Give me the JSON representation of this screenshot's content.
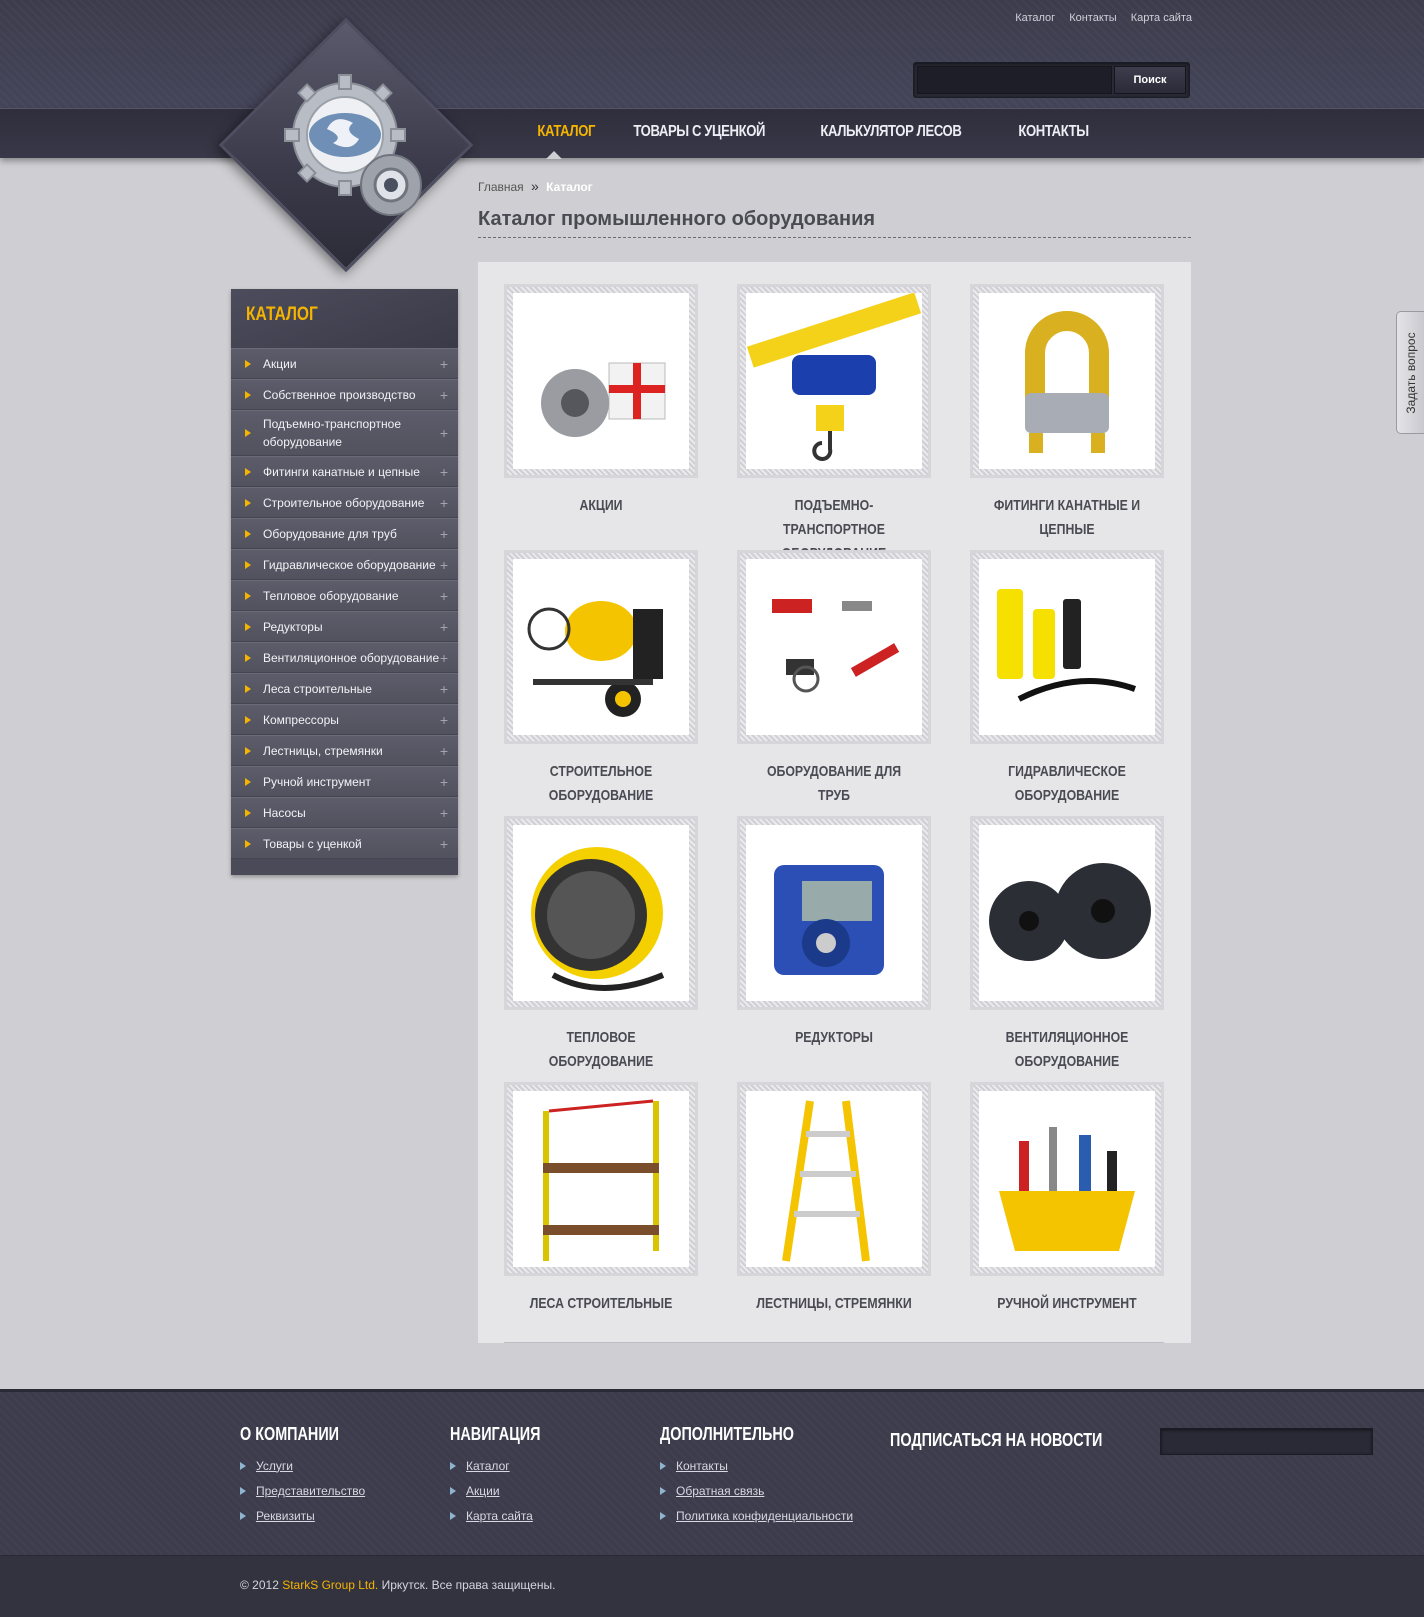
{
  "top_links": [
    "Каталог",
    "Контакты",
    "Карта сайта"
  ],
  "search": {
    "placeholder": "",
    "button": "Поиск"
  },
  "main_nav": [
    {
      "label": "Каталог",
      "active": true
    },
    {
      "label": "Товары с уценкой",
      "active": false
    },
    {
      "label": "Калькулятор лесов",
      "active": false
    },
    {
      "label": "Контакты",
      "active": false
    }
  ],
  "breadcrumb": {
    "home": "Главная",
    "separator": "»",
    "current": "Каталог"
  },
  "page_title": "Каталог промышленного оборудования",
  "sidebar": {
    "title": "Каталог",
    "items": [
      "Акции",
      "Собственное производство",
      "Подъемно-транспортное оборудование",
      "Фитинги канатные и цепные",
      "Строительное оборудование",
      "Оборудование для труб",
      "Гидравлическое оборудование",
      "Тепловое оборудование",
      "Редукторы",
      "Вентиляционное оборудование",
      "Леса строительные",
      "Компрессоры",
      "Лестницы, стремянки",
      "Ручной инструмент",
      "Насосы",
      "Товары с уценкой"
    ]
  },
  "catalog": [
    {
      "label": "Акции",
      "icon": "gift-pulley-image"
    },
    {
      "label": "Подъемно-транспортное оборудование",
      "icon": "hoist-image"
    },
    {
      "label": "Фитинги канатные и цепные",
      "icon": "wire-clamp-image"
    },
    {
      "label": "Строительное оборудование",
      "icon": "concrete-mixer-image"
    },
    {
      "label": "Оборудование для труб",
      "icon": "pipe-tools-image"
    },
    {
      "label": "Гидравлическое оборудование",
      "icon": "hydraulic-cylinders-image"
    },
    {
      "label": "Тепловое оборудование",
      "icon": "heater-image"
    },
    {
      "label": "Редукторы",
      "icon": "gearbox-image"
    },
    {
      "label": "Вентиляционное оборудование",
      "icon": "fans-image"
    },
    {
      "label": "Леса строительные",
      "icon": "scaffold-image"
    },
    {
      "label": "Лестницы, стремянки",
      "icon": "ladder-image"
    },
    {
      "label": "Ручной инструмент",
      "icon": "toolbox-image"
    }
  ],
  "ask_tab": "Задать вопрос",
  "footer": {
    "about": {
      "title": "О компании",
      "links": [
        "Услуги",
        "Представительство",
        "Реквизиты"
      ]
    },
    "navigation": {
      "title": "Навигация",
      "links": [
        "Каталог",
        "Акции",
        "Карта сайта"
      ]
    },
    "extra": {
      "title": "Дополнительно",
      "links": [
        "Контакты",
        "Обратная связь",
        "Политика конфиденциальности"
      ]
    },
    "subscribe": {
      "title": "Подписаться на новости",
      "placeholder": ""
    }
  },
  "copyright": {
    "prefix": "© 2012 ",
    "brand": "StarkS Group Ltd.",
    "suffix": " Иркутск. Все права защищены."
  },
  "colors": {
    "accent": "#f5b400",
    "header_bg": "#3c3c4c",
    "page_bg": "#cfcfd3"
  }
}
